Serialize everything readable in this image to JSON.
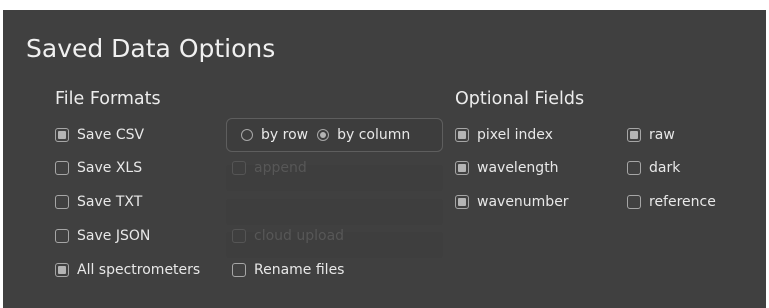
{
  "title": "Saved Data Options",
  "file_formats": {
    "heading": "File Formats",
    "items": [
      {
        "label": "Save CSV",
        "checked": true
      },
      {
        "label": "Save XLS",
        "checked": false
      },
      {
        "label": "Save TXT",
        "checked": false
      },
      {
        "label": "Save JSON",
        "checked": false
      },
      {
        "label": "All spectrometers",
        "checked": true
      }
    ]
  },
  "csv_layout": {
    "options": [
      {
        "label": "by row",
        "selected": false
      },
      {
        "label": "by column",
        "selected": true
      }
    ]
  },
  "append": {
    "label": "append",
    "checked": false,
    "enabled": false
  },
  "cloud_upload": {
    "label": "cloud upload",
    "checked": false,
    "enabled": false
  },
  "rename_files": {
    "label": "Rename files",
    "checked": false
  },
  "optional_fields": {
    "heading": "Optional Fields",
    "items": [
      {
        "label": "pixel index",
        "checked": true
      },
      {
        "label": "wavelength",
        "checked": true
      },
      {
        "label": "wavenumber",
        "checked": true
      },
      {
        "label": "raw",
        "checked": true
      },
      {
        "label": "dark",
        "checked": false
      },
      {
        "label": "reference",
        "checked": false
      }
    ]
  },
  "colors": {
    "panel_background": "#404040",
    "text": "#e8e8e8",
    "disabled_text": "#575757"
  }
}
